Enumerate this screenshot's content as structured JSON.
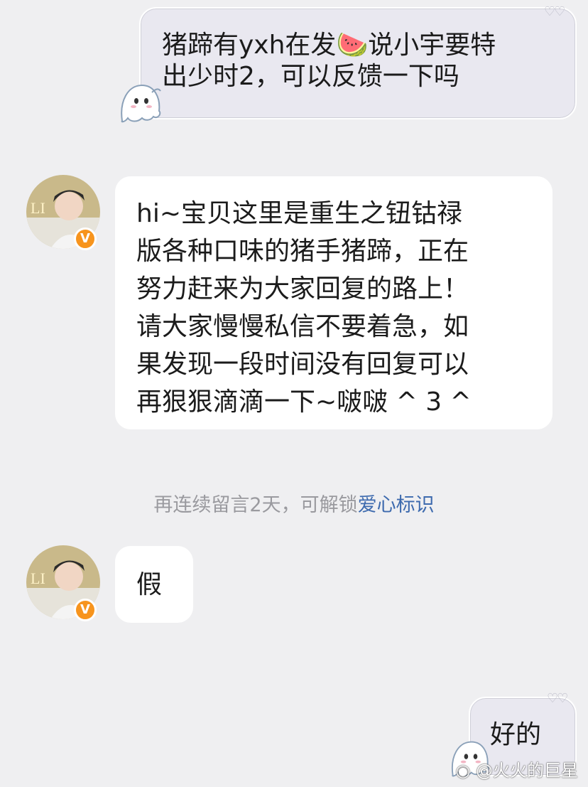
{
  "messages": {
    "outgoing_1": {
      "line1_pre": "猪蹄有yxh在发",
      "emoji": "🍉",
      "line1_post": "说小宇要特",
      "line2": "出少时2，可以反馈一下吗"
    },
    "incoming_1": {
      "lines": [
        "hi~宝贝这里是重生之钮钴禄",
        "版各种口味的猪手猪蹄，正在",
        "努力赶来为大家回复的路上！",
        "请大家慢慢私信不要着急，如",
        "果发现一段时间没有回复可以",
        "再狠狠滴滴一下~啵啵 ^ 3 ^"
      ]
    },
    "incoming_2": {
      "text": "假"
    },
    "outgoing_2": {
      "text": "好的"
    }
  },
  "system_notice": {
    "text": "再连续留言2天，可解锁",
    "link": "爱心标识"
  },
  "avatar": {
    "badge": "V",
    "logo_text": "LI",
    "badge_color": "#f7941d"
  },
  "watermark": "@火火的巨星",
  "colors": {
    "background": "#efeff1",
    "outgoing_bubble": "#e9e8f0",
    "incoming_bubble": "#ffffff",
    "link": "#3d6aae"
  }
}
